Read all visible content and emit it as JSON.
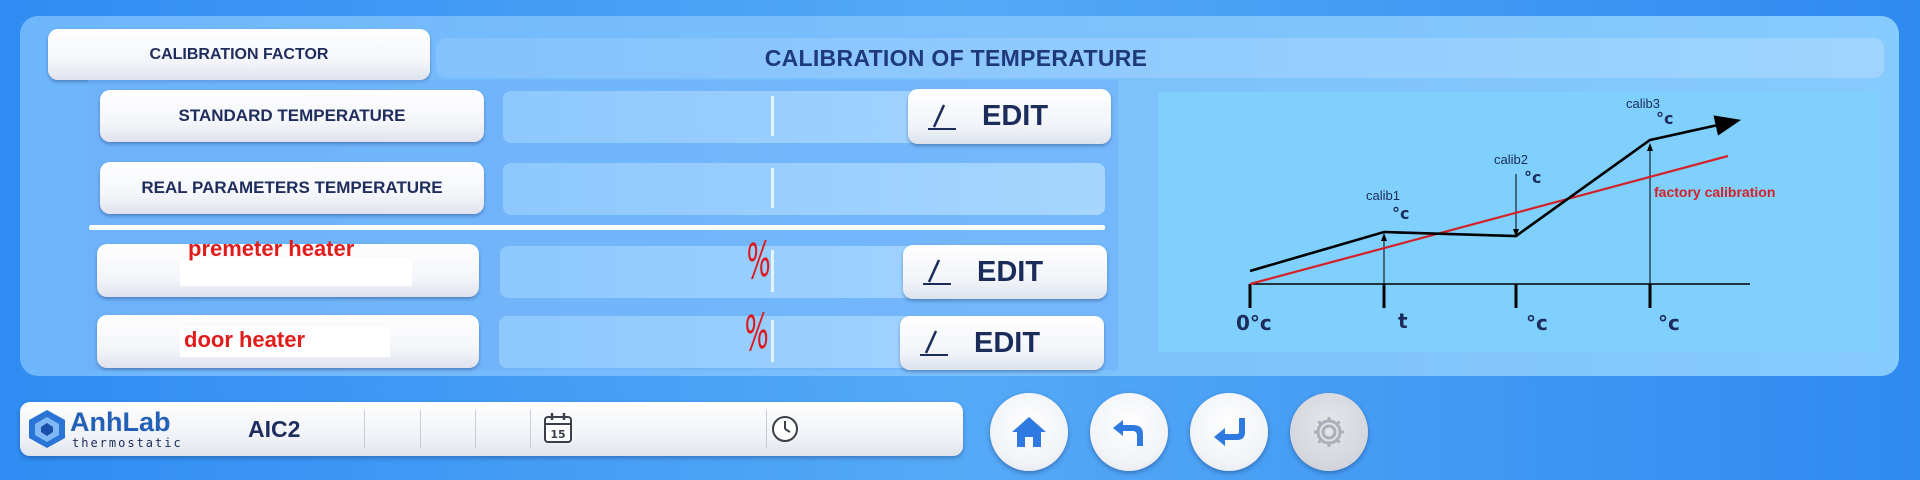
{
  "header": {
    "calibration_factor_label": "CALIBRATION FACTOR",
    "title": "CALIBRATION OF TEMPERATURE"
  },
  "rows": {
    "standard_temperature": {
      "label": "STANDARD TEMPERATURE",
      "edit_label": "EDIT"
    },
    "real_parameters_temperature": {
      "label": "REAL PARAMETERS TEMPERATURE"
    },
    "premeter_heater": {
      "label": "premeter heater",
      "unit": "%",
      "edit_label": "EDIT"
    },
    "door_heater": {
      "label": "door heater",
      "unit": "%",
      "edit_label": "EDIT"
    }
  },
  "graph": {
    "calib1": "calib1",
    "calib2": "calib2",
    "calib3": "calib3",
    "factory_calibration": "factory calibration",
    "deg_c": "°c",
    "x_axis_origin": "0°c",
    "x_tick_1": "t",
    "x_tick_2": "°c",
    "x_tick_3": "°c",
    "colors": {
      "measured_line": "#000000",
      "factory_line": "#d42127"
    }
  },
  "status_bar": {
    "brand": "AnhLab",
    "brand_sub": "thermostatic",
    "device_name": "AIC2",
    "calendar_day": "15",
    "icons": [
      "calendar-icon",
      "clock-icon"
    ]
  },
  "nav": {
    "icons": [
      "home-icon",
      "back-icon",
      "enter-icon",
      "settings-icon"
    ],
    "settings_disabled": true
  },
  "colors": {
    "title_text": "#1e3a7a",
    "red_text": "#e21b1b",
    "nav_icon": "#2e7ae0"
  }
}
